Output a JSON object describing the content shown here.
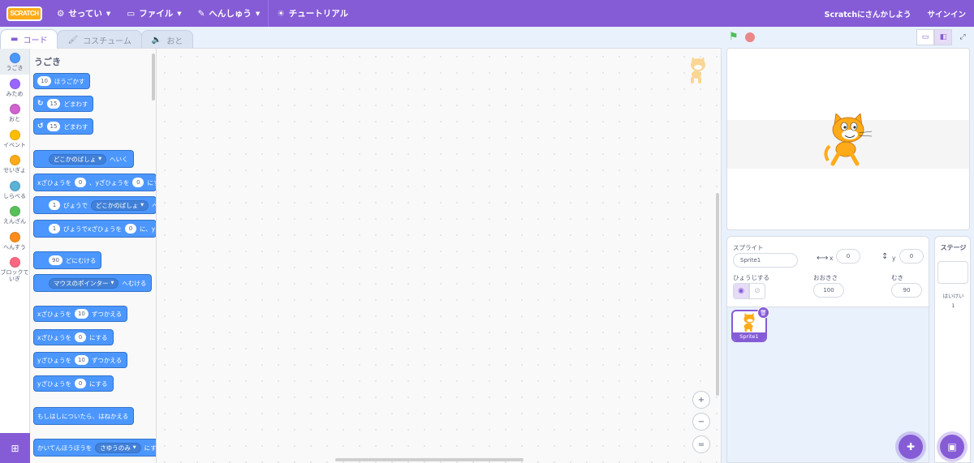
{
  "menubar": {
    "logo": "SCRATCH",
    "settings": "せってい",
    "file": "ファイル",
    "edit": "へんしゅう",
    "tutorial": "チュートリアル",
    "join": "Scratchにさんかしよう",
    "signin": "サインイン",
    "bg_color": "#855cd6"
  },
  "tabs": {
    "code": "コード",
    "costumes": "コスチューム",
    "sounds": "おと"
  },
  "categories": [
    {
      "label": "うごき",
      "color": "#4c97ff"
    },
    {
      "label": "みため",
      "color": "#9966ff"
    },
    {
      "label": "おと",
      "color": "#cf63cf"
    },
    {
      "label": "イベント",
      "color": "#ffbf00"
    },
    {
      "label": "せいぎょ",
      "color": "#ffab19"
    },
    {
      "label": "しらべる",
      "color": "#5cb1d6"
    },
    {
      "label": "えんざん",
      "color": "#59c059"
    },
    {
      "label": "へんすう",
      "color": "#ff8c1a"
    },
    {
      "label_line1": "ブロックて",
      "label_line2": "いぎ",
      "color": "#ff6680"
    }
  ],
  "palette": {
    "title": "うごき",
    "move": {
      "value": "10",
      "text": "ほうごかす"
    },
    "turn_right": {
      "value": "15",
      "text": "どまわす"
    },
    "turn_left": {
      "value": "15",
      "text": "どまわす"
    },
    "goto": {
      "option": "どこかのばしょ",
      "text": "へいく"
    },
    "goto_xy": {
      "t1": "xざひょうを",
      "v1": "0",
      "t2": "、yざひょうを",
      "v2": "0",
      "t3": "にする"
    },
    "glide": {
      "v1": "1",
      "t1": "びょうで",
      "option": "どこかのばしょ",
      "t2": "へい"
    },
    "glide_xy": {
      "v1": "1",
      "t1": "びょうでxざひょうを",
      "v2": "0",
      "t2": "に、yざ"
    },
    "point_dir": {
      "value": "90",
      "text": "どにむける"
    },
    "point_towards": {
      "option": "マウスのポインター",
      "text": "へむける"
    },
    "change_x": {
      "t1": "xざひょうを",
      "value": "10",
      "t2": "ずつかえる"
    },
    "set_x": {
      "t1": "xざひょうを",
      "value": "0",
      "t2": "にする"
    },
    "change_y": {
      "t1": "yざひょうを",
      "value": "10",
      "t2": "ずつかえる"
    },
    "set_y": {
      "t1": "yざひょうを",
      "value": "0",
      "t2": "にする"
    },
    "bounce": "もしはしについたら、はねかえる",
    "rotation_style": {
      "t1": "かいてんほうほうを",
      "option": "さゆうのみ",
      "t2": "にする"
    }
  },
  "stage_controls": {
    "zoom_in": "+",
    "zoom_out": "−",
    "zoom_reset": "="
  },
  "sprite_info": {
    "label_sprite": "スプライト",
    "sprite_name": "Sprite1",
    "x_label": "x",
    "x_value": "0",
    "y_label": "y",
    "y_value": "0",
    "show_label": "ひょうじする",
    "size_label": "おおきさ",
    "size_value": "100",
    "direction_label": "むき",
    "direction_value": "90"
  },
  "sprites": [
    {
      "name": "Sprite1"
    }
  ],
  "stage_pane": {
    "title": "ステージ",
    "backdrops_label": "はいけい",
    "backdrops_count": "1"
  }
}
